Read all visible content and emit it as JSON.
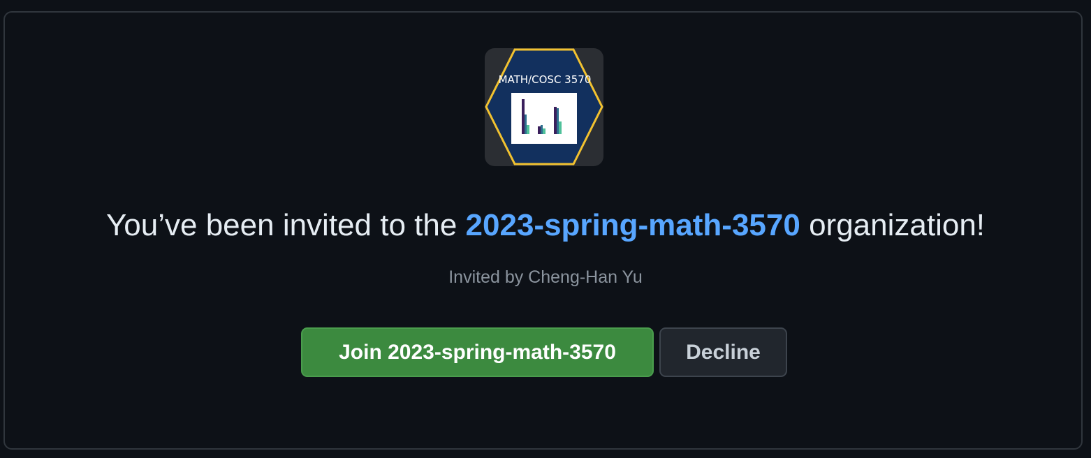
{
  "avatar": {
    "label": "MATH/COSC 3570",
    "icon": "org-avatar-bar-chart",
    "colors": {
      "background": "#12305e",
      "border": "#f2c230",
      "chart_bg": "#ffffff"
    }
  },
  "invitation": {
    "prefix": "You’ve been invited to the ",
    "org_name": "2023-spring-math-3570",
    "suffix": " organization!",
    "invited_by": "Invited by Cheng-Han Yu"
  },
  "actions": {
    "join_label": "Join 2023-spring-math-3570",
    "decline_label": "Decline"
  },
  "colors": {
    "page_bg": "#0d1117",
    "link": "#58a6ff",
    "join_bg": "#3c8a3f",
    "decline_bg": "#21262d"
  }
}
